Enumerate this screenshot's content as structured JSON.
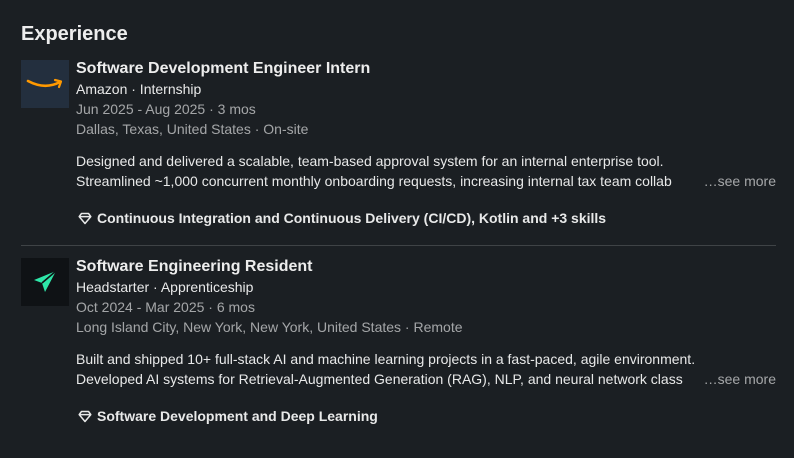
{
  "section": {
    "title": "Experience"
  },
  "experiences": [
    {
      "logo": "amazon-logo",
      "role": "Software Development Engineer Intern",
      "company": "Amazon · Internship",
      "dates": "Jun 2025 - Aug 2025 · 3 mos",
      "location": "Dallas, Texas, United States · On-site",
      "desc_line1": "Designed and delivered a scalable, team-based approval system for an internal enterprise tool.",
      "desc_line2": "Streamlined ~1,000 concurrent monthly onboarding requests, increasing internal tax team collab",
      "see_more": "…see more",
      "skills": "Continuous Integration and Continuous Delivery (CI/CD), Kotlin and +3 skills"
    },
    {
      "logo": "headstarter-logo",
      "role": "Software Engineering Resident",
      "company": "Headstarter · Apprenticeship",
      "dates": "Oct 2024 - Mar 2025 · 6 mos",
      "location": "Long Island City, New York, New York, United States · Remote",
      "desc_line1": "Built and shipped 10+ full-stack AI and machine learning projects in a fast-paced, agile environment.",
      "desc_line2": "Developed AI systems for Retrieval-Augmented Generation (RAG), NLP, and neural network class",
      "see_more": "…see more",
      "skills": "Software Development and Deep Learning"
    }
  ],
  "colors": {
    "background": "#1b1f23",
    "amazon_logo_bg": "#232f3e",
    "amazon_smile": "#ff9900",
    "headstarter_accent": "#2ee6a8"
  }
}
